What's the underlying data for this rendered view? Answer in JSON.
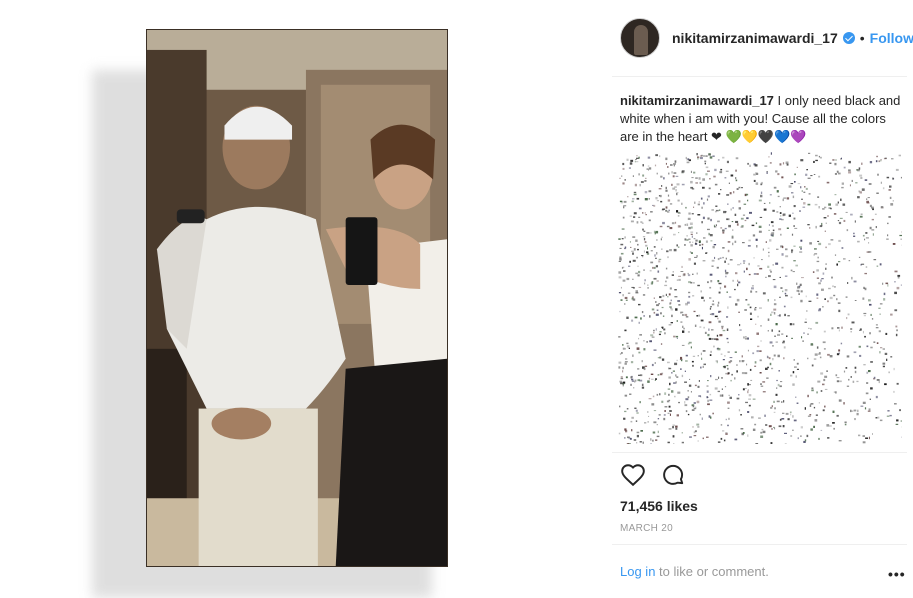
{
  "post": {
    "username": "nikitamirzanimawardi_17",
    "follow_label": "Follow",
    "separator": "•",
    "caption_user": "nikitamirzanimawardi_17",
    "caption_text": " I only need black and white when i am with you! Cause all the colors are in the heart ❤︎ 💚💛🖤💙💜",
    "likes": "71,456 likes",
    "date": "MARCH 20",
    "login_link": "Log in",
    "login_rest": " to like or comment.",
    "more_label": "•••"
  },
  "colors": {
    "accent": "#3897f0",
    "text": "#262626",
    "muted": "#999999"
  }
}
